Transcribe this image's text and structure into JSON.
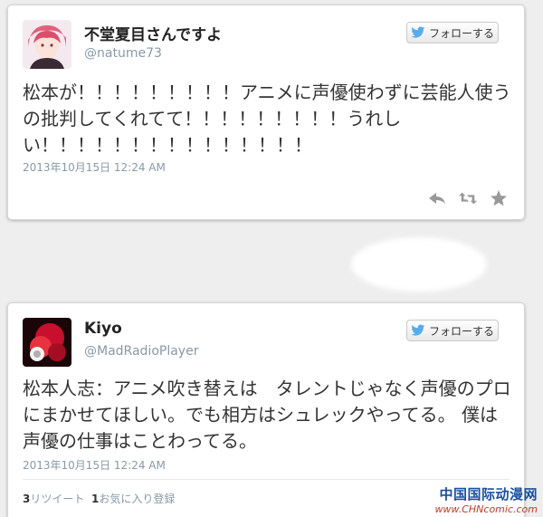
{
  "tweets": [
    {
      "name": "不堂夏目さんですよ",
      "handle": "@natume73",
      "follow_label": "フォローする",
      "text": "松本が！！！！！！！！！アニメに声優使わずに芸能人使うの批判してくれてて！！！！！！！！！うれしい！！！！！！！！！！！！！！！",
      "time": "2013年10月15日 12:24 AM"
    },
    {
      "name": "Kiyo",
      "handle": "@MadRadioPlayer",
      "follow_label": "フォローする",
      "text": "松本人志：アニメ吹き替えは　タレントじゃなく声優のプロにまかせてほしい。でも相方はシュレックやってる。 僕は　声優の仕事はことわってる。",
      "time": "2013年10月15日 12:24 AM",
      "retweets_count": "3",
      "retweets_label": "リツイート",
      "favorites_count": "1",
      "favorites_label": "お気に入り登録"
    }
  ],
  "icons": [
    "twitter-bird-icon",
    "reply-icon",
    "retweet-icon",
    "favorite-star-icon"
  ],
  "watermark": {
    "main": "中国国际动漫网",
    "sub": "www.CHNcomic.com"
  },
  "colors": {
    "handle": "#8899a6",
    "twitter_blue": "#55acee",
    "text": "#333333"
  }
}
